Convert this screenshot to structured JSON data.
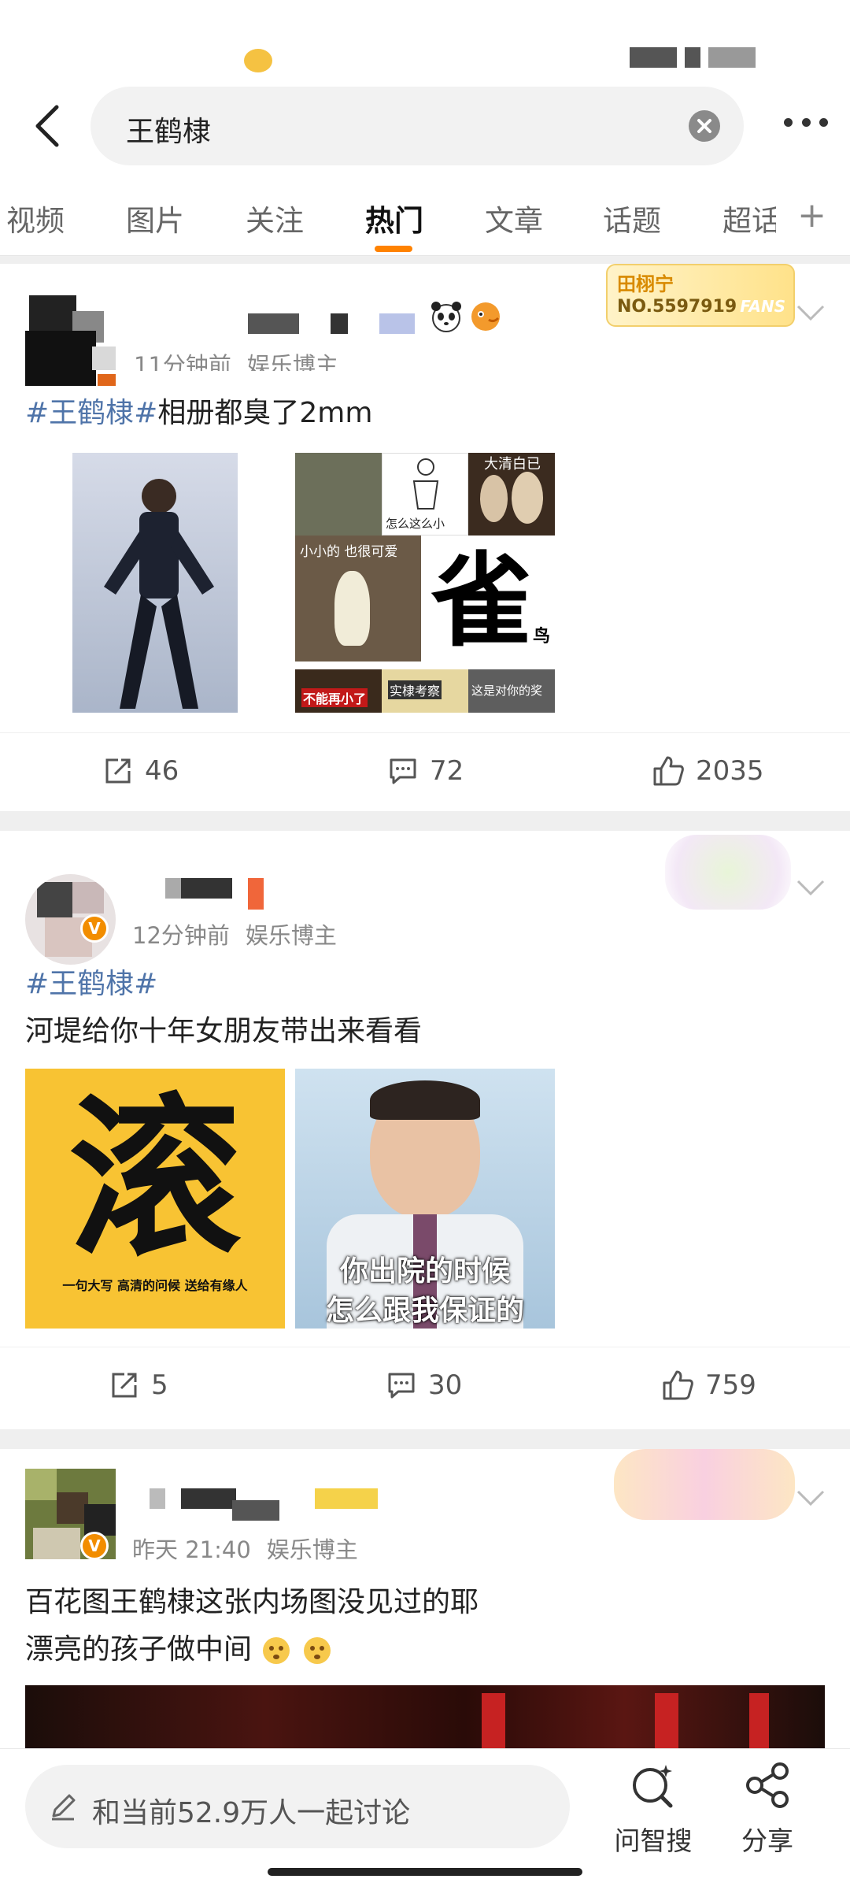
{
  "search": {
    "query": "王鹤棣"
  },
  "tabs": [
    {
      "label": "视频"
    },
    {
      "label": "图片"
    },
    {
      "label": "关注"
    },
    {
      "label": "热门"
    },
    {
      "label": "文章"
    },
    {
      "label": "话题"
    },
    {
      "label": "超话"
    }
  ],
  "posts": [
    {
      "meta_time": "11分钟前",
      "meta_role": "娱乐博主",
      "fan_badge_name": "田栩宁",
      "fan_badge_no": "NO.5597919",
      "fan_badge_fans": "FANS",
      "tag": "#王鹤棣#",
      "text": "相册都臭了2mm",
      "img_captions": [
        "怎么这么小",
        "大清白已",
        "小小的 也很可爱",
        "雀",
        "鸟",
        "不能再小了",
        "实棣考察",
        "这是对你的奖"
      ],
      "reposts": "46",
      "comments": "72",
      "likes": "2035"
    },
    {
      "meta_time": "12分钟前",
      "meta_role": "娱乐博主",
      "tag": "#王鹤棣#",
      "text": "河堤给你十年女朋友带出来看看",
      "img1_big": "滚",
      "img1_small": "一句大写  高清的问候  送给有缘人",
      "img2_line1": "你出院的时候",
      "img2_line2": "怎么跟我保证的",
      "reposts": "5",
      "comments": "30",
      "likes": "759"
    },
    {
      "meta_time": "昨天 21:40",
      "meta_role": "娱乐博主",
      "text_line1": "百花图王鹤棣这张内场图没见过的耶",
      "text_line2": "漂亮的孩子做中间"
    }
  ],
  "bottom": {
    "discuss_placeholder": "和当前52.9万人一起讨论",
    "ask_label": "问智搜",
    "share_label": "分享"
  },
  "colors": {
    "accent": "#ff8200",
    "tag": "#4f74a9"
  }
}
